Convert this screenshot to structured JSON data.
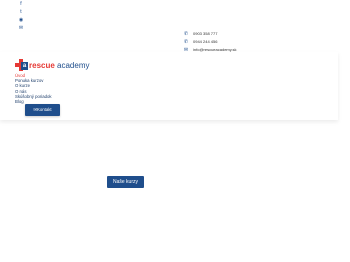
{
  "social": {
    "icons": [
      "facebook-icon",
      "twitter-icon",
      "instagram-icon",
      "mail-icon"
    ],
    "glyphs": [
      "f",
      "t",
      "◉",
      "✉"
    ]
  },
  "contacts": {
    "phone1": "0903 358 777",
    "phone2": "0944 244 456",
    "email": "info@rescueacademy.sk"
  },
  "logo": {
    "brand_red": "rescue",
    "brand_blue": "academy",
    "mark_letter": "a"
  },
  "nav": {
    "items": [
      {
        "label": "Úvod",
        "active": true
      },
      {
        "label": "Ponuka kurzov",
        "active": false
      },
      {
        "label": "O kurze",
        "active": false
      },
      {
        "label": "O nás",
        "active": false
      },
      {
        "label": "Skúšobný poriadok",
        "active": false
      },
      {
        "label": "Blog",
        "active": false
      }
    ]
  },
  "buttons": {
    "kontakt": "Kontakt",
    "kontakt_icon": "✉",
    "nase_kurzy": "Naše kurzy"
  },
  "colors": {
    "brand_blue": "#1f4e8c",
    "brand_red": "#e53935"
  }
}
